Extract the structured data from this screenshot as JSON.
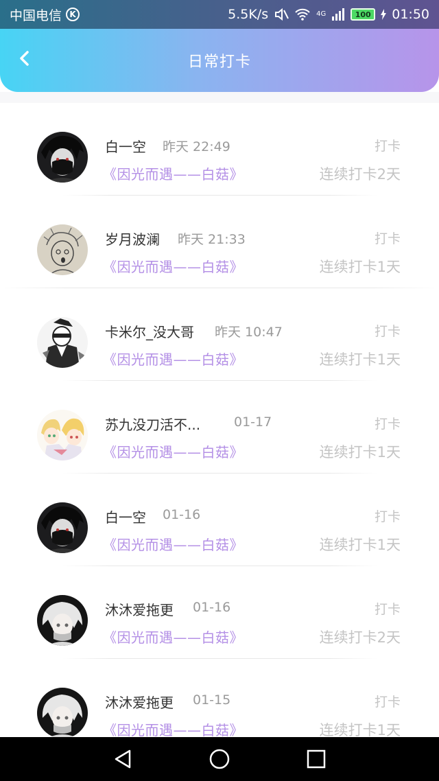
{
  "status_bar": {
    "carrier": "中国电信",
    "carrier_badge": "K",
    "speed": "5.5K/s",
    "network": "4G",
    "battery": "100",
    "time": "01:50"
  },
  "header": {
    "title": "日常打卡",
    "gradient_start": "#47d4f4",
    "gradient_end": "#b794ea"
  },
  "colors": {
    "book_title": "#b490e6",
    "muted": "#c4c4c4"
  },
  "entries": [
    {
      "name": "白一空",
      "time": "昨天 22:49",
      "book": "《因光而遇——白菇》",
      "action": "打卡",
      "streak": "连续打卡2天",
      "avatar": "dark-masked-boy"
    },
    {
      "name": "岁月波澜",
      "time": "昨天 21:33",
      "book": "《因光而遇——白菇》",
      "action": "打卡",
      "streak": "连续打卡1天",
      "avatar": "sketch-face"
    },
    {
      "name": "卡米尔_没大哥",
      "time": "昨天 10:47",
      "book": "《因光而遇——白菇》",
      "action": "打卡",
      "streak": "连续打卡1天",
      "avatar": "monochrome-character"
    },
    {
      "name": "苏九没刀活不...",
      "time": "01-17",
      "book": "《因光而遇——白菇》",
      "action": "打卡",
      "streak": "连续打卡1天",
      "avatar": "chibi-pair"
    },
    {
      "name": "白一空",
      "time": "01-16",
      "book": "《因光而遇——白菇》",
      "action": "打卡",
      "streak": "连续打卡1天",
      "avatar": "dark-masked-boy"
    },
    {
      "name": "沐沐爱拖更",
      "time": "01-16",
      "book": "《因光而遇——白菇》",
      "action": "打卡",
      "streak": "连续打卡2天",
      "avatar": "white-haired-girl"
    },
    {
      "name": "沐沐爱拖更",
      "time": "01-15",
      "book": "《因光而遇——白菇》",
      "action": "打卡",
      "streak": "连续打卡1天",
      "avatar": "white-haired-girl"
    }
  ]
}
